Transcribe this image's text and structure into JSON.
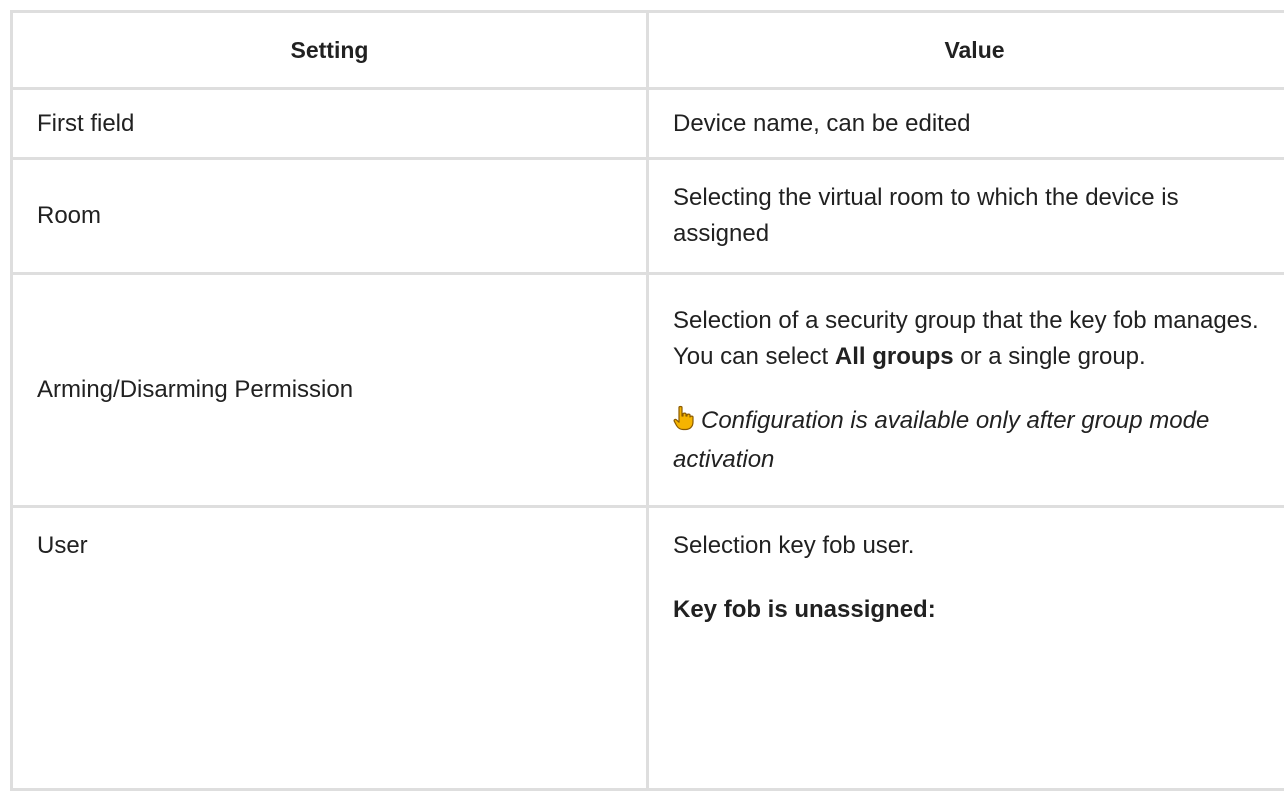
{
  "table": {
    "headers": {
      "setting": "Setting",
      "value": "Value"
    },
    "rows": [
      {
        "setting": "First field",
        "value": "Device name, can be edited"
      },
      {
        "setting": "Room",
        "value": "Selecting the virtual room to which the device is assigned"
      },
      {
        "setting": "Arming/Disarming Permission",
        "value_before": "Selection of a security group that the key fob manages. You can select ",
        "value_bold": "All groups",
        "value_after": " or a single group.",
        "hint_icon": "pointing-hand-icon",
        "hint": "Configuration is available only after group mode activation"
      },
      {
        "setting": "User",
        "value": "Selection key fob user.",
        "subheading": "Key fob is unassigned:"
      }
    ]
  },
  "colors": {
    "border": "#dedede",
    "text": "#212121",
    "hand_icon": "#f5b400"
  }
}
